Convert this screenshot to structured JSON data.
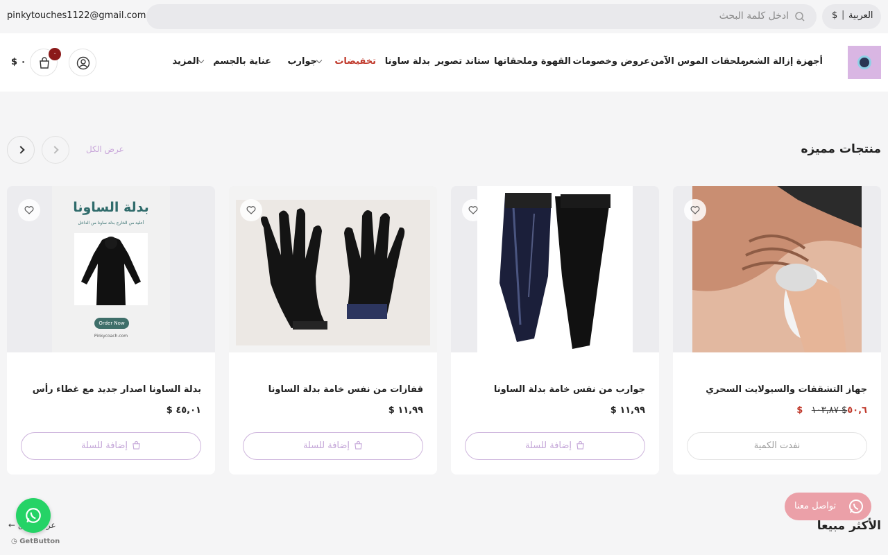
{
  "topbar": {
    "email": "pinkytouches1122@gmail.com",
    "search_placeholder": "ادخل كلمة البحث",
    "language": "العربية",
    "separator": "|",
    "currency": "$"
  },
  "header": {
    "nav": [
      {
        "label": "أجهزة إزالة الشعر"
      },
      {
        "label": "ملحقات الموس الآمن"
      },
      {
        "label": "عروض وخصومات"
      },
      {
        "label": "القهوة وملحقاتها"
      },
      {
        "label": "ستاند تصوير"
      },
      {
        "label": "بدلة ساونا"
      },
      {
        "label": "تخفيضات"
      },
      {
        "label": "جوارب"
      },
      {
        "label": "عناية بالجسم"
      },
      {
        "label": "المزيد"
      }
    ],
    "cart_count": "٠",
    "cart_total": "$ ٠"
  },
  "featured": {
    "title": "منتجات مميزه",
    "view_all": "عرض الكل",
    "products": [
      {
        "name": "جهاز التشققات والسيولايت السحري",
        "price": "$ ٥٠,٦",
        "old_price": "$ ١٠٣,٨٧",
        "button": "نفدت الكمية"
      },
      {
        "name": "جوارب من نفس خامة بدلة الساونا",
        "price": "$ ١١,٩٩",
        "button": "إضافة للسلة"
      },
      {
        "name": "قفازات من نفس خامة بدلة الساونا",
        "price": "$ ١١,٩٩",
        "button": "إضافة للسلة"
      },
      {
        "name": "بدلة الساونا اصدار جديد مع غطاء رأس",
        "price": "$ ٤٥,٠١",
        "button": "إضافة للسلة"
      }
    ],
    "poster": {
      "title": "بدلة الساونا",
      "subtitle": "أعلية من الخارج بدلة ساونا من الداخل",
      "cta": "Order Now",
      "site": "Pinkycoach.com"
    }
  },
  "bestsellers": {
    "title": "الأكثر مبيعا",
    "view_all": "عرض الكل"
  },
  "widgets": {
    "contact": "تواصل معنا",
    "getbutton": "GetButton"
  },
  "colors": {
    "accent": "#cdb4dc",
    "sale": "#c0392b",
    "whatsapp": "#25d366",
    "contact": "#eba0a8"
  }
}
